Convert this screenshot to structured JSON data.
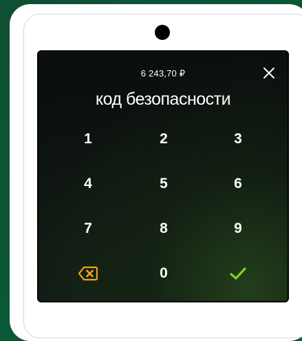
{
  "payment": {
    "amount": "6 243,70 ₽",
    "title": "код безопасности"
  },
  "keypad": {
    "keys": [
      "1",
      "2",
      "3",
      "4",
      "5",
      "6",
      "7",
      "8",
      "9",
      "0"
    ]
  },
  "icons": {
    "close": "close-icon",
    "backspace": "backspace-icon",
    "confirm": "checkmark-icon"
  },
  "colors": {
    "backspace": "#f5a31a",
    "confirm": "#7ed321",
    "background": "#0a5a38"
  }
}
